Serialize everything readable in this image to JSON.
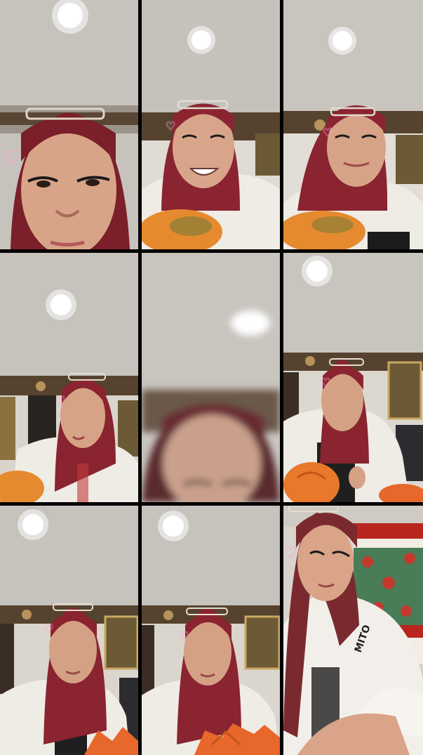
{
  "grid": {
    "rows": 3,
    "columns": 3,
    "background": "#000000"
  },
  "frames": [
    {
      "id": "f1",
      "scene": "selfie-closeup",
      "sticker": "heart-icon"
    },
    {
      "id": "f2",
      "scene": "smiling-with-papaya",
      "sticker": "heart-icon"
    },
    {
      "id": "f3",
      "scene": "smiling-with-papaya",
      "sticker": "heart-icon"
    },
    {
      "id": "f4",
      "scene": "eating-papaya",
      "sticker": "heart-icon"
    },
    {
      "id": "f5",
      "scene": "blurred-motion",
      "sticker": ""
    },
    {
      "id": "f6",
      "scene": "cutting-papaya",
      "sticker": "heart-icon"
    },
    {
      "id": "f7",
      "scene": "eating-papaya",
      "sticker": "heart-icon"
    },
    {
      "id": "f8",
      "scene": "eating-papaya",
      "sticker": "heart-icon"
    },
    {
      "id": "f9",
      "scene": "closeup-curtain",
      "sticker": "heart-icon"
    }
  ],
  "colors": {
    "ceiling": "#c9c5c0",
    "lamp": "#ffffff",
    "hair": "#8a2a30",
    "skin": "#d9a58c",
    "shirt": "#ece8e2",
    "papaya": "#e2762a",
    "wall_trim": "#4a3a2a",
    "sticker": "#ff78b4"
  }
}
